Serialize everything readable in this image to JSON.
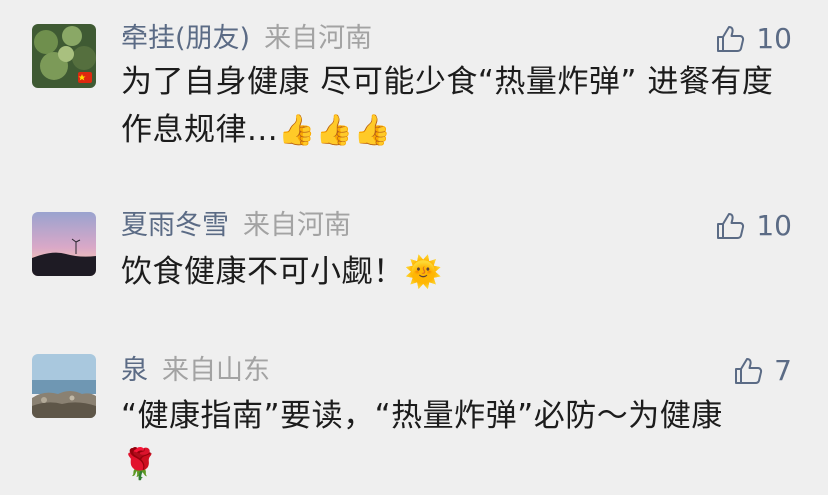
{
  "comments": [
    {
      "name": "牵挂(朋友)",
      "region": "来自河南",
      "likes": "10",
      "text": "为了自身健康 尽可能少食“热量炸弹” 进餐有度 作息规律...",
      "emoji": "👍👍👍"
    },
    {
      "name": "夏雨冬雪",
      "region": "来自河南",
      "likes": "10",
      "text": "饮食健康不可小觑！",
      "emoji": "🌞"
    },
    {
      "name": "泉",
      "region": "来自山东",
      "likes": "7",
      "text": "“健康指南”要读，“热量炸弹”必防～为健康",
      "emoji": "🌹"
    }
  ],
  "colors": {
    "background": "#efefef",
    "name": "#5b6b85",
    "region": "#a3a3a3",
    "text": "#1c1c1c"
  }
}
